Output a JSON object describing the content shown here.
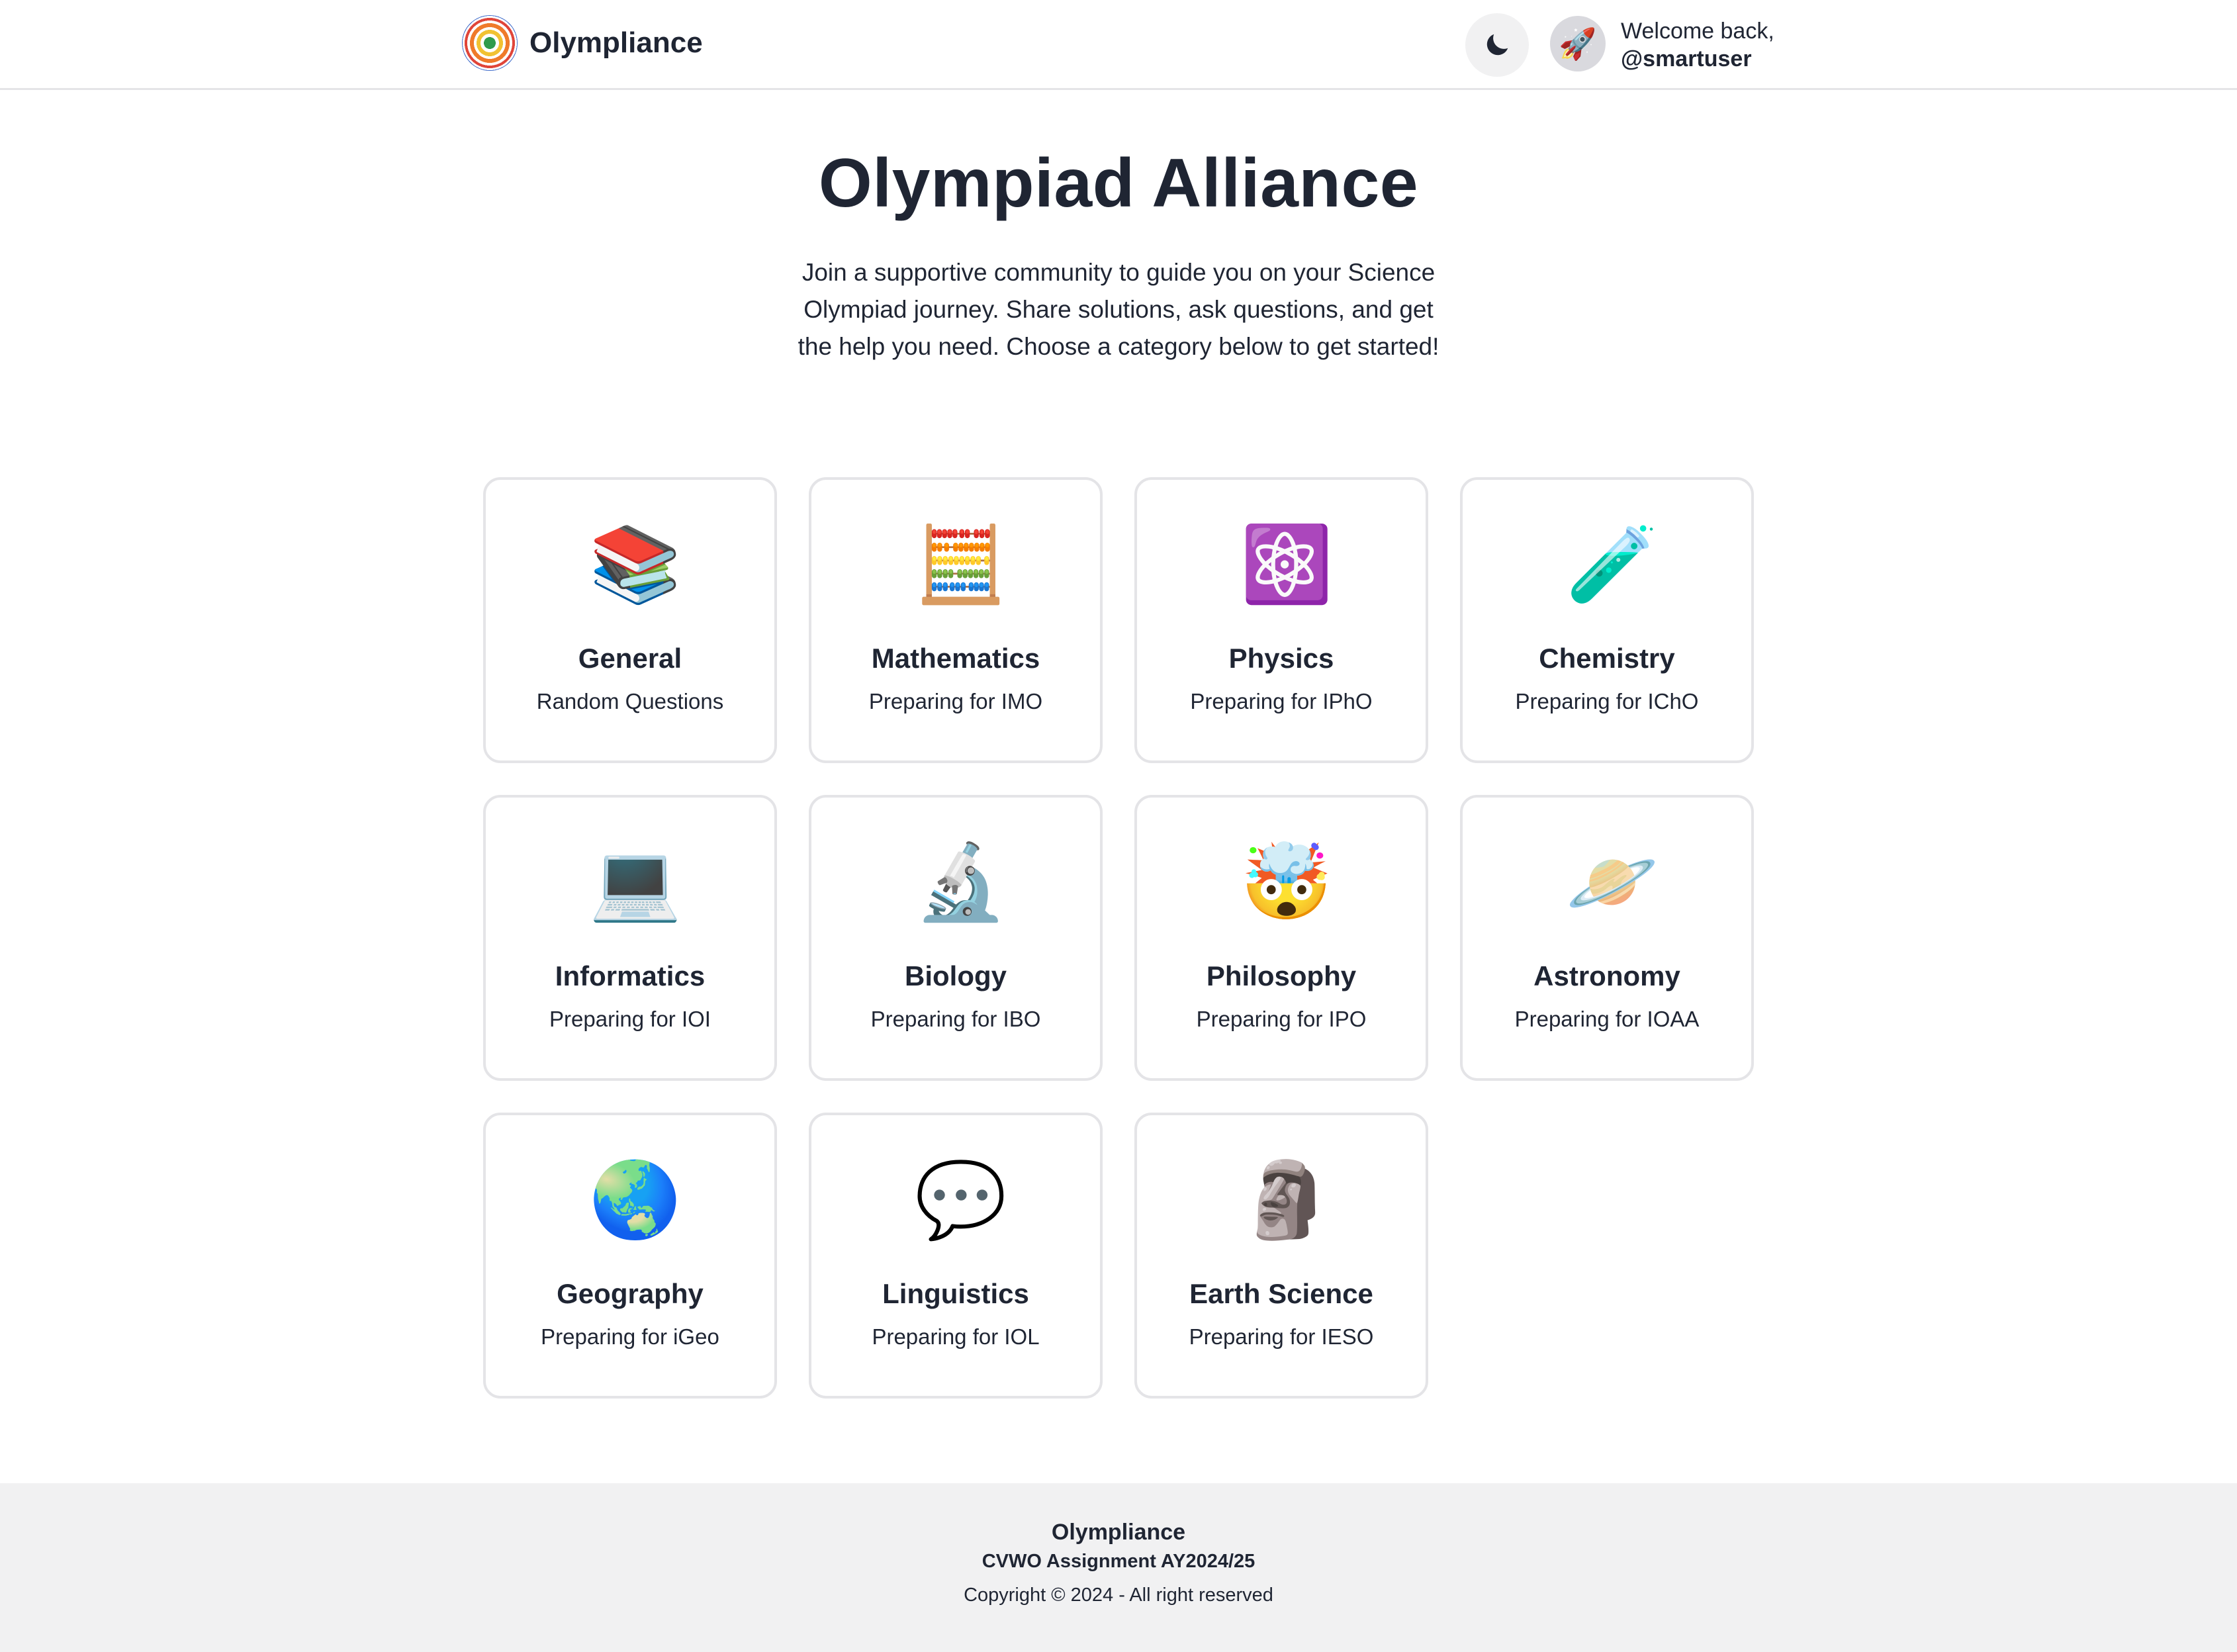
{
  "header": {
    "brand": "Olympliance",
    "welcome_line1": "Welcome back,",
    "username": "@smartuser",
    "avatar_emoji": "🚀",
    "theme_icon": "moon-icon"
  },
  "hero": {
    "title": "Olympiad Alliance",
    "description": "Join a supportive community to guide you on your Science Olympiad journey. Share solutions, ask questions, and get the help you need. Choose a category below to get started!"
  },
  "categories": [
    {
      "emoji": "📚",
      "icon": "books-icon",
      "title": "General",
      "subtitle": "Random Questions"
    },
    {
      "emoji": "🧮",
      "icon": "abacus-icon",
      "title": "Mathematics",
      "subtitle": "Preparing for IMO"
    },
    {
      "emoji": "⚛️",
      "icon": "atom-icon",
      "title": "Physics",
      "subtitle": "Preparing for IPhO"
    },
    {
      "emoji": "🧪",
      "icon": "test-tube-icon",
      "title": "Chemistry",
      "subtitle": "Preparing for IChO"
    },
    {
      "emoji": "💻",
      "icon": "laptop-icon",
      "title": "Informatics",
      "subtitle": "Preparing for IOI"
    },
    {
      "emoji": "🔬",
      "icon": "microscope-icon",
      "title": "Biology",
      "subtitle": "Preparing for IBO"
    },
    {
      "emoji": "🤯",
      "icon": "exploding-head-icon",
      "title": "Philosophy",
      "subtitle": "Preparing for IPO"
    },
    {
      "emoji": "🪐",
      "icon": "ringed-planet-icon",
      "title": "Astronomy",
      "subtitle": "Preparing for IOAA"
    },
    {
      "emoji": "🌏",
      "icon": "globe-icon",
      "title": "Geography",
      "subtitle": "Preparing for iGeo"
    },
    {
      "emoji": "💬",
      "icon": "speech-bubble-icon",
      "title": "Linguistics",
      "subtitle": "Preparing for IOL"
    },
    {
      "emoji": "🗿",
      "icon": "moai-icon",
      "title": "Earth Science",
      "subtitle": "Preparing for IESO"
    }
  ],
  "footer": {
    "name": "Olympliance",
    "assignment": "CVWO Assignment AY2024/25",
    "copyright": "Copyright © 2024 - All right reserved"
  },
  "colors": {
    "text": "#1f2533",
    "border": "#e4e4e7",
    "footer_bg": "#f1f1f2"
  }
}
